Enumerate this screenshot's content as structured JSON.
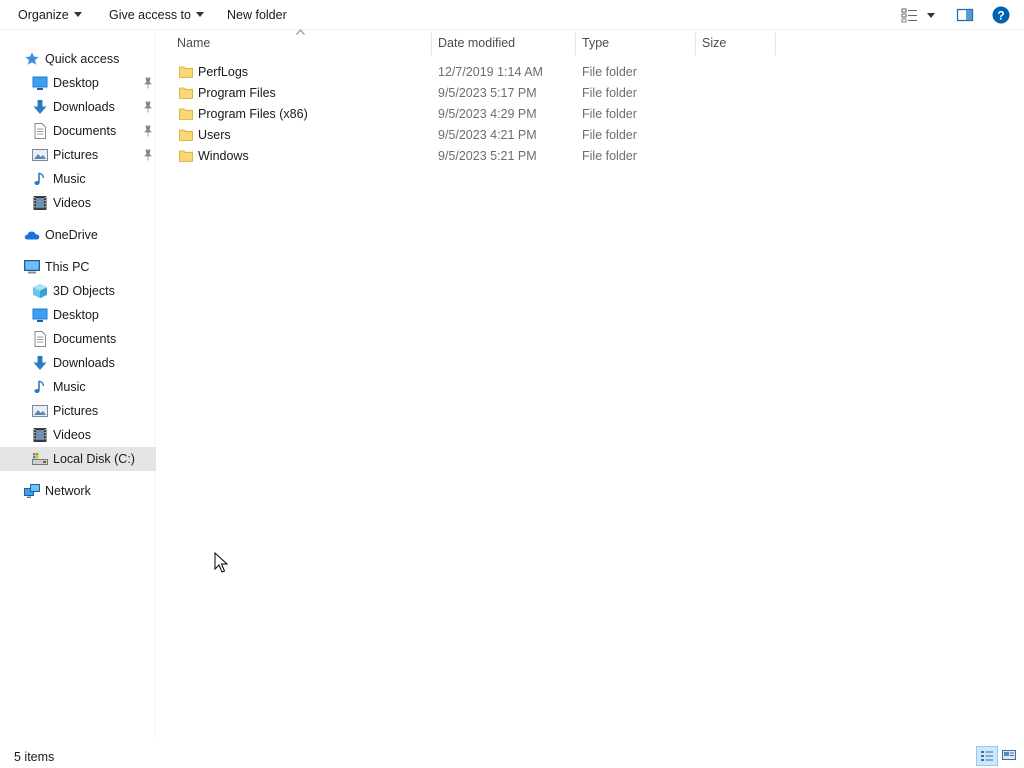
{
  "toolbar": {
    "organize_label": "Organize",
    "give_access_label": "Give access to",
    "new_folder_label": "New folder",
    "icons": [
      "view-options-icon",
      "preview-pane-icon",
      "help-icon"
    ]
  },
  "sidebar": {
    "quick_access": {
      "label": "Quick access",
      "items": [
        {
          "label": "Desktop",
          "icon": "desktop-icon",
          "pinned": true
        },
        {
          "label": "Downloads",
          "icon": "downloads-icon",
          "pinned": true
        },
        {
          "label": "Documents",
          "icon": "documents-icon",
          "pinned": true
        },
        {
          "label": "Pictures",
          "icon": "pictures-icon",
          "pinned": true
        },
        {
          "label": "Music",
          "icon": "music-icon",
          "pinned": false
        },
        {
          "label": "Videos",
          "icon": "videos-icon",
          "pinned": false
        }
      ]
    },
    "onedrive_label": "OneDrive",
    "this_pc": {
      "label": "This PC",
      "items": [
        {
          "label": "3D Objects",
          "icon": "3d-objects-icon"
        },
        {
          "label": "Desktop",
          "icon": "desktop-icon"
        },
        {
          "label": "Documents",
          "icon": "documents-icon"
        },
        {
          "label": "Downloads",
          "icon": "downloads-icon"
        },
        {
          "label": "Music",
          "icon": "music-icon"
        },
        {
          "label": "Pictures",
          "icon": "pictures-icon"
        },
        {
          "label": "Videos",
          "icon": "videos-icon"
        },
        {
          "label": "Local Disk (C:)",
          "icon": "local-disk-icon",
          "selected": true
        }
      ]
    },
    "network_label": "Network"
  },
  "file_list": {
    "columns": [
      "Name",
      "Date modified",
      "Type",
      "Size"
    ],
    "sort_column": "Name",
    "rows": [
      {
        "name": "PerfLogs",
        "date": "12/7/2019 1:14 AM",
        "type": "File folder",
        "size": ""
      },
      {
        "name": "Program Files",
        "date": "9/5/2023 5:17 PM",
        "type": "File folder",
        "size": ""
      },
      {
        "name": "Program Files (x86)",
        "date": "9/5/2023 4:29 PM",
        "type": "File folder",
        "size": ""
      },
      {
        "name": "Users",
        "date": "9/5/2023 4:21 PM",
        "type": "File folder",
        "size": ""
      },
      {
        "name": "Windows",
        "date": "9/5/2023 5:21 PM",
        "type": "File folder",
        "size": ""
      }
    ]
  },
  "status_bar": {
    "item_count": "5 items",
    "active_view": "details"
  },
  "colors": {
    "selection_bg": "#e5e5e5",
    "folder_yellow": "#f8d775",
    "accent_blue": "#0078d7",
    "muted_text": "#6d6d6d"
  }
}
